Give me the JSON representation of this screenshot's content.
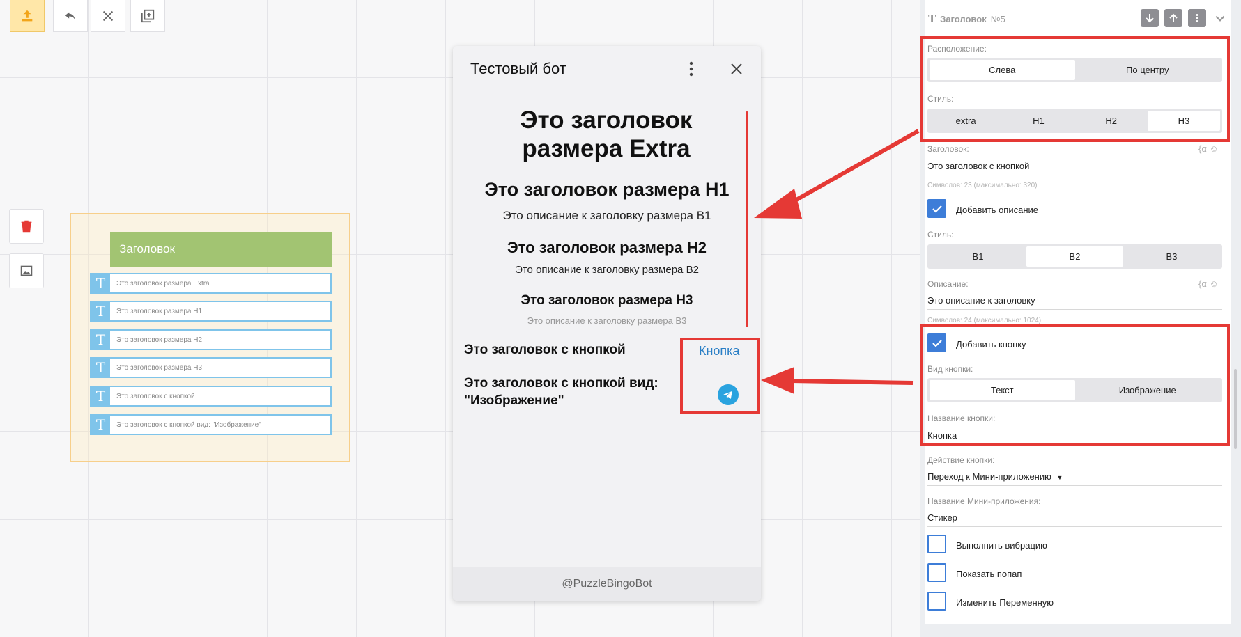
{
  "colors": {
    "accent_red": "#e53935",
    "block_header": "#a2c472",
    "row_blue": "#7fc4ea",
    "checkbox_blue": "#3d7dd8",
    "telegram_blue": "#2aa3df",
    "link_blue": "#2a7fc6"
  },
  "toolbar": {
    "items": [
      {
        "icon": "upload-icon",
        "active": true
      },
      {
        "icon": "undo-icon"
      },
      {
        "icon": "close-icon"
      },
      {
        "icon": "add-copy-icon"
      }
    ]
  },
  "side_tools": [
    {
      "icon": "trash-icon"
    },
    {
      "icon": "image-frame-icon"
    }
  ],
  "block": {
    "header": "Заголовок",
    "rows": [
      {
        "icon_letter": "T",
        "label": "Это заголовок размера Extra"
      },
      {
        "icon_letter": "T",
        "label": "Это заголовок размера H1"
      },
      {
        "icon_letter": "T",
        "label": "Это заголовок размера H2"
      },
      {
        "icon_letter": "T",
        "label": "Это заголовок размера H3"
      },
      {
        "icon_letter": "T",
        "label": "Это заголовок с кнопкой"
      },
      {
        "icon_letter": "T",
        "label": "Это заголовок с кнопкой вид: \"Изображение\""
      }
    ]
  },
  "preview": {
    "title": "Тестовый бот",
    "heading_extra": "Это заголовок размера Extra",
    "heading_h1": "Это заголовок размера H1",
    "desc_b1": "Это описание к заголовку размера B1",
    "heading_h2": "Это заголовок размера H2",
    "desc_b2": "Это описание к заголовку размера B2",
    "heading_h3": "Это заголовок размера H3",
    "desc_b3": "Это описание к заголовку размера B3",
    "heading_button": "Это заголовок с кнопкой",
    "button_label": "Кнопка",
    "heading_button_image": "Это заголовок с кнопкой вид: \"Изображение\"",
    "footer": "@PuzzleBingoBot"
  },
  "panel": {
    "title": "Заголовок",
    "number": "№5",
    "location_label": "Расположение:",
    "location_options": [
      "Слева",
      "По центру"
    ],
    "location_selected": 0,
    "style_label": "Стиль:",
    "style_options": [
      "extra",
      "H1",
      "H2",
      "H3"
    ],
    "style_selected": 3,
    "heading_label": "Заголовок:",
    "heading_value": "Это заголовок с кнопкой",
    "heading_hint": "Символов: 23 (максимально: 320)",
    "add_description_label": "Добавить описание",
    "add_description_checked": true,
    "desc_style_label": "Стиль:",
    "desc_style_options": [
      "B1",
      "B2",
      "B3"
    ],
    "desc_style_selected": 1,
    "description_label": "Описание:",
    "description_value": "Это описание к заголовку",
    "description_hint": "Символов: 24 (максимально: 1024)",
    "add_button_label": "Добавить кнопку",
    "add_button_checked": true,
    "button_type_label": "Вид кнопки:",
    "button_type_options": [
      "Текст",
      "Изображение"
    ],
    "button_type_selected": 0,
    "button_name_label": "Название кнопки:",
    "button_name_value": "Кнопка",
    "button_action_label": "Действие кнопки:",
    "button_action_value": "Переход к Мини-приложению",
    "miniapp_label": "Название Мини-приложения:",
    "miniapp_value": "Стикер",
    "vibration_label": "Выполнить вибрацию",
    "popup_label": "Показать попап",
    "variable_label": "Изменить Переменную"
  }
}
